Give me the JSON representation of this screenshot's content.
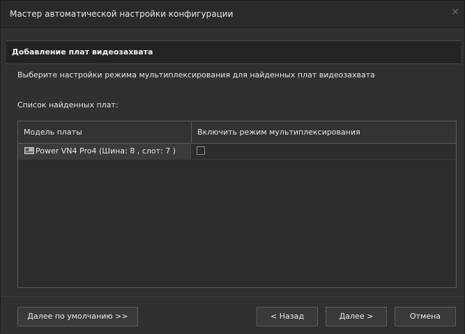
{
  "window": {
    "title": "Мастер автоматической настройки конфигурации",
    "close_icon": "close-icon"
  },
  "section": {
    "title": "Добавление плат видеозахвата"
  },
  "description": "Выберите настройки режима мультиплексирования для найденных плат видеозахвата",
  "list_label": "Список найденных плат:",
  "table": {
    "columns": [
      "Модель платы",
      "Включить режим мультиплексирования"
    ],
    "rows": [
      {
        "icon": "capture-board-icon",
        "model": "Power VN4 Pro4  (Шина: 8 , слот: 7 )",
        "multiplex_enabled": false
      }
    ]
  },
  "buttons": {
    "default": "Далее по умолчанию >>",
    "back": "< Назад",
    "next": "Далее >",
    "cancel": "Отмена"
  },
  "colors": {
    "background": "#303030",
    "title_bar": "#2a2a2a",
    "header_strip": "#232323",
    "text": "#e6e6e6",
    "border": "#5a5a5a"
  }
}
